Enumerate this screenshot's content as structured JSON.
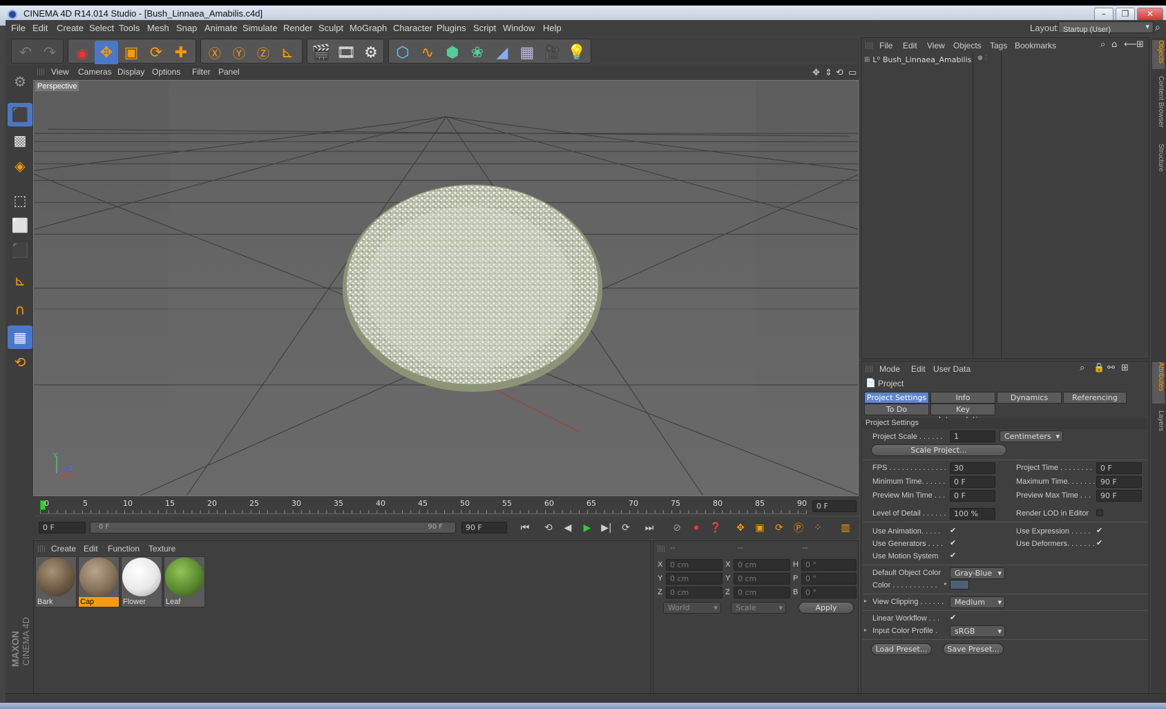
{
  "window": {
    "title": "CINEMA 4D R14.014 Studio - [Bush_Linnaea_Amabilis.c4d]",
    "min": "–",
    "max": "❐",
    "close": "✕"
  },
  "menu": [
    "File",
    "Edit",
    "Create",
    "Select",
    "Tools",
    "Mesh",
    "Snap",
    "Animate",
    "Simulate",
    "Render",
    "Sculpt",
    "MoGraph",
    "Character",
    "Plugins",
    "Script",
    "Window",
    "Help"
  ],
  "layout": {
    "label": "Layout:",
    "value": "Startup (User)"
  },
  "viewport": {
    "menu": [
      "View",
      "Cameras",
      "Display",
      "Options",
      "Filter",
      "Panel"
    ],
    "label": "Perspective",
    "axis_y": "Y",
    "axis_z": "Z",
    "axis_x": "X"
  },
  "timeline": {
    "ticks": [
      "0",
      "5",
      "10",
      "15",
      "20",
      "25",
      "30",
      "35",
      "40",
      "45",
      "50",
      "55",
      "60",
      "65",
      "70",
      "75",
      "80",
      "85",
      "90"
    ],
    "current_frame": "0 F"
  },
  "playbar": {
    "start": "0 F",
    "range_start": "0 F",
    "range_end": "90 F",
    "end": "90 F"
  },
  "materials": {
    "menu": [
      "Create",
      "Edit",
      "Function",
      "Texture"
    ],
    "items": [
      {
        "name": "Bark",
        "color": "#6b5a44",
        "selected": false
      },
      {
        "name": "Cap",
        "color": "#857259",
        "selected": true
      },
      {
        "name": "Flower",
        "color": "#e8e8e8",
        "selected": false
      },
      {
        "name": "Leaf",
        "color": "#5b8a2e",
        "selected": false
      }
    ]
  },
  "coords": {
    "headers": [
      "--",
      "--",
      "--"
    ],
    "rows": [
      {
        "l1": "X",
        "v1": "0 cm",
        "l2": "X",
        "v2": "0 cm",
        "l3": "H",
        "v3": "0 °"
      },
      {
        "l1": "Y",
        "v1": "0 cm",
        "l2": "Y",
        "v2": "0 cm",
        "l3": "P",
        "v3": "0 °"
      },
      {
        "l1": "Z",
        "v1": "0 cm",
        "l2": "Z",
        "v2": "0 cm",
        "l3": "B",
        "v3": "0 °"
      }
    ],
    "world": "World",
    "scale": "Scale",
    "apply": "Apply"
  },
  "objects": {
    "menu": [
      "File",
      "Edit",
      "View",
      "Objects",
      "Tags",
      "Bookmarks"
    ],
    "tree": [
      {
        "name": "Bush_Linnaea_Amabilis"
      }
    ]
  },
  "attributes": {
    "menu": [
      "Mode",
      "Edit",
      "User Data"
    ],
    "header": "Project",
    "tabs_row1": [
      "Project Settings",
      "Info",
      "Dynamics",
      "Referencing"
    ],
    "tabs_row2": [
      "To Do",
      "Key Interpolation"
    ],
    "section": "Project Settings",
    "project_scale_label": "Project Scale . . . . . .",
    "project_scale_value": "1",
    "project_scale_unit": "Centimeters",
    "scale_project_btn": "Scale Project...",
    "fps_label": "FPS . . . . . . . . . . . . . .",
    "fps_value": "30",
    "project_time_label": "Project Time . . . . . . . .",
    "project_time_value": "0 F",
    "min_time_label": "Minimum Time. . . . . .",
    "min_time_value": "0 F",
    "max_time_label": "Maximum Time. . . . . . .",
    "max_time_value": "90 F",
    "prev_min_label": "Preview Min Time . . .",
    "prev_min_value": "0 F",
    "prev_max_label": "Preview Max Time . . .",
    "prev_max_value": "90 F",
    "lod_label": "Level of Detail . . . . . .",
    "lod_value": "100 %",
    "render_lod_label": "Render LOD in Editor",
    "use_animation": "Use Animation. . . . .",
    "use_expression": "Use Expression . . . . .",
    "use_generators": "Use Generators . . . .",
    "use_deformers": "Use Deformers. . . . . . .",
    "use_motion": "Use Motion System",
    "default_color_label": "Default Object Color",
    "default_color_value": "Gray-Blue",
    "color_label": "Color . . . . . . . . . . .",
    "view_clipping_label": "View Clipping . . . . . .",
    "view_clipping_value": "Medium",
    "linear_workflow_label": "Linear Workflow . . .",
    "input_profile_label": "Input Color Profile .",
    "input_profile_value": "sRGB",
    "load_preset": "Load Preset...",
    "save_preset": "Save Preset..."
  },
  "side_tabs": [
    "Objects",
    "Content Browser",
    "Structure",
    "Attributes",
    "Layers"
  ],
  "brand": {
    "maxon": "MAXON",
    "cinema": "CINEMA 4D"
  }
}
